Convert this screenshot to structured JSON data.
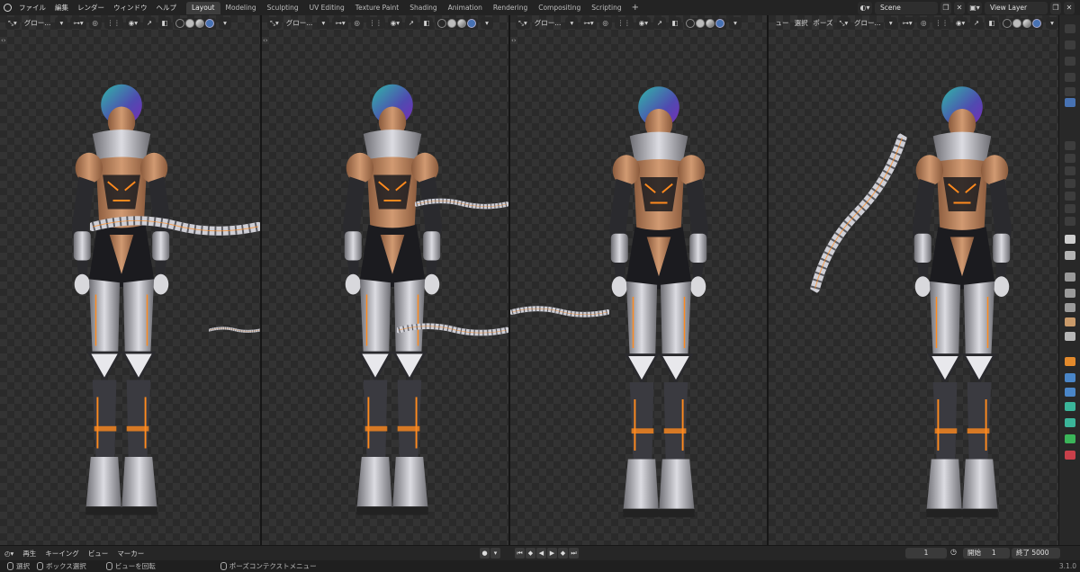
{
  "app": {
    "menus": [
      "ファイル",
      "編集",
      "レンダー",
      "ウィンドウ",
      "ヘルプ"
    ],
    "workspaces": [
      {
        "label": "Layout",
        "active": true
      },
      {
        "label": "Modeling",
        "active": false
      },
      {
        "label": "Sculpting",
        "active": false
      },
      {
        "label": "UV Editing",
        "active": false
      },
      {
        "label": "Texture Paint",
        "active": false
      },
      {
        "label": "Shading",
        "active": false
      },
      {
        "label": "Animation",
        "active": false
      },
      {
        "label": "Rendering",
        "active": false
      },
      {
        "label": "Compositing",
        "active": false
      },
      {
        "label": "Scripting",
        "active": false
      }
    ],
    "add_workspace": "+",
    "scene": "Scene",
    "view_layer": "View Layer"
  },
  "viewports": [
    {
      "orientation": "グロー...",
      "menus": []
    },
    {
      "orientation": "グロー...",
      "menus": []
    },
    {
      "orientation": "グロー...",
      "menus": []
    },
    {
      "orientation": "グロー...",
      "menus": [
        "ュー",
        "選択",
        "ポーズ"
      ]
    }
  ],
  "timeline": {
    "playback": "再生",
    "keying": "キーイング",
    "view": "ビュー",
    "marker": "マーカー",
    "current_frame": "1",
    "start_label": "開始",
    "start": "1",
    "end_label": "終了",
    "end": "5000"
  },
  "statusbar": {
    "select": "選択",
    "box_select": "ボックス選択",
    "rotate_view": "ビューを回転",
    "context_menu": "ポーズコンテクストメニュー",
    "version": "3.1.0"
  },
  "colors": {
    "accent": "#4772b3",
    "active_tab": "#3d3d3d",
    "bg": "#1d1d1d"
  }
}
